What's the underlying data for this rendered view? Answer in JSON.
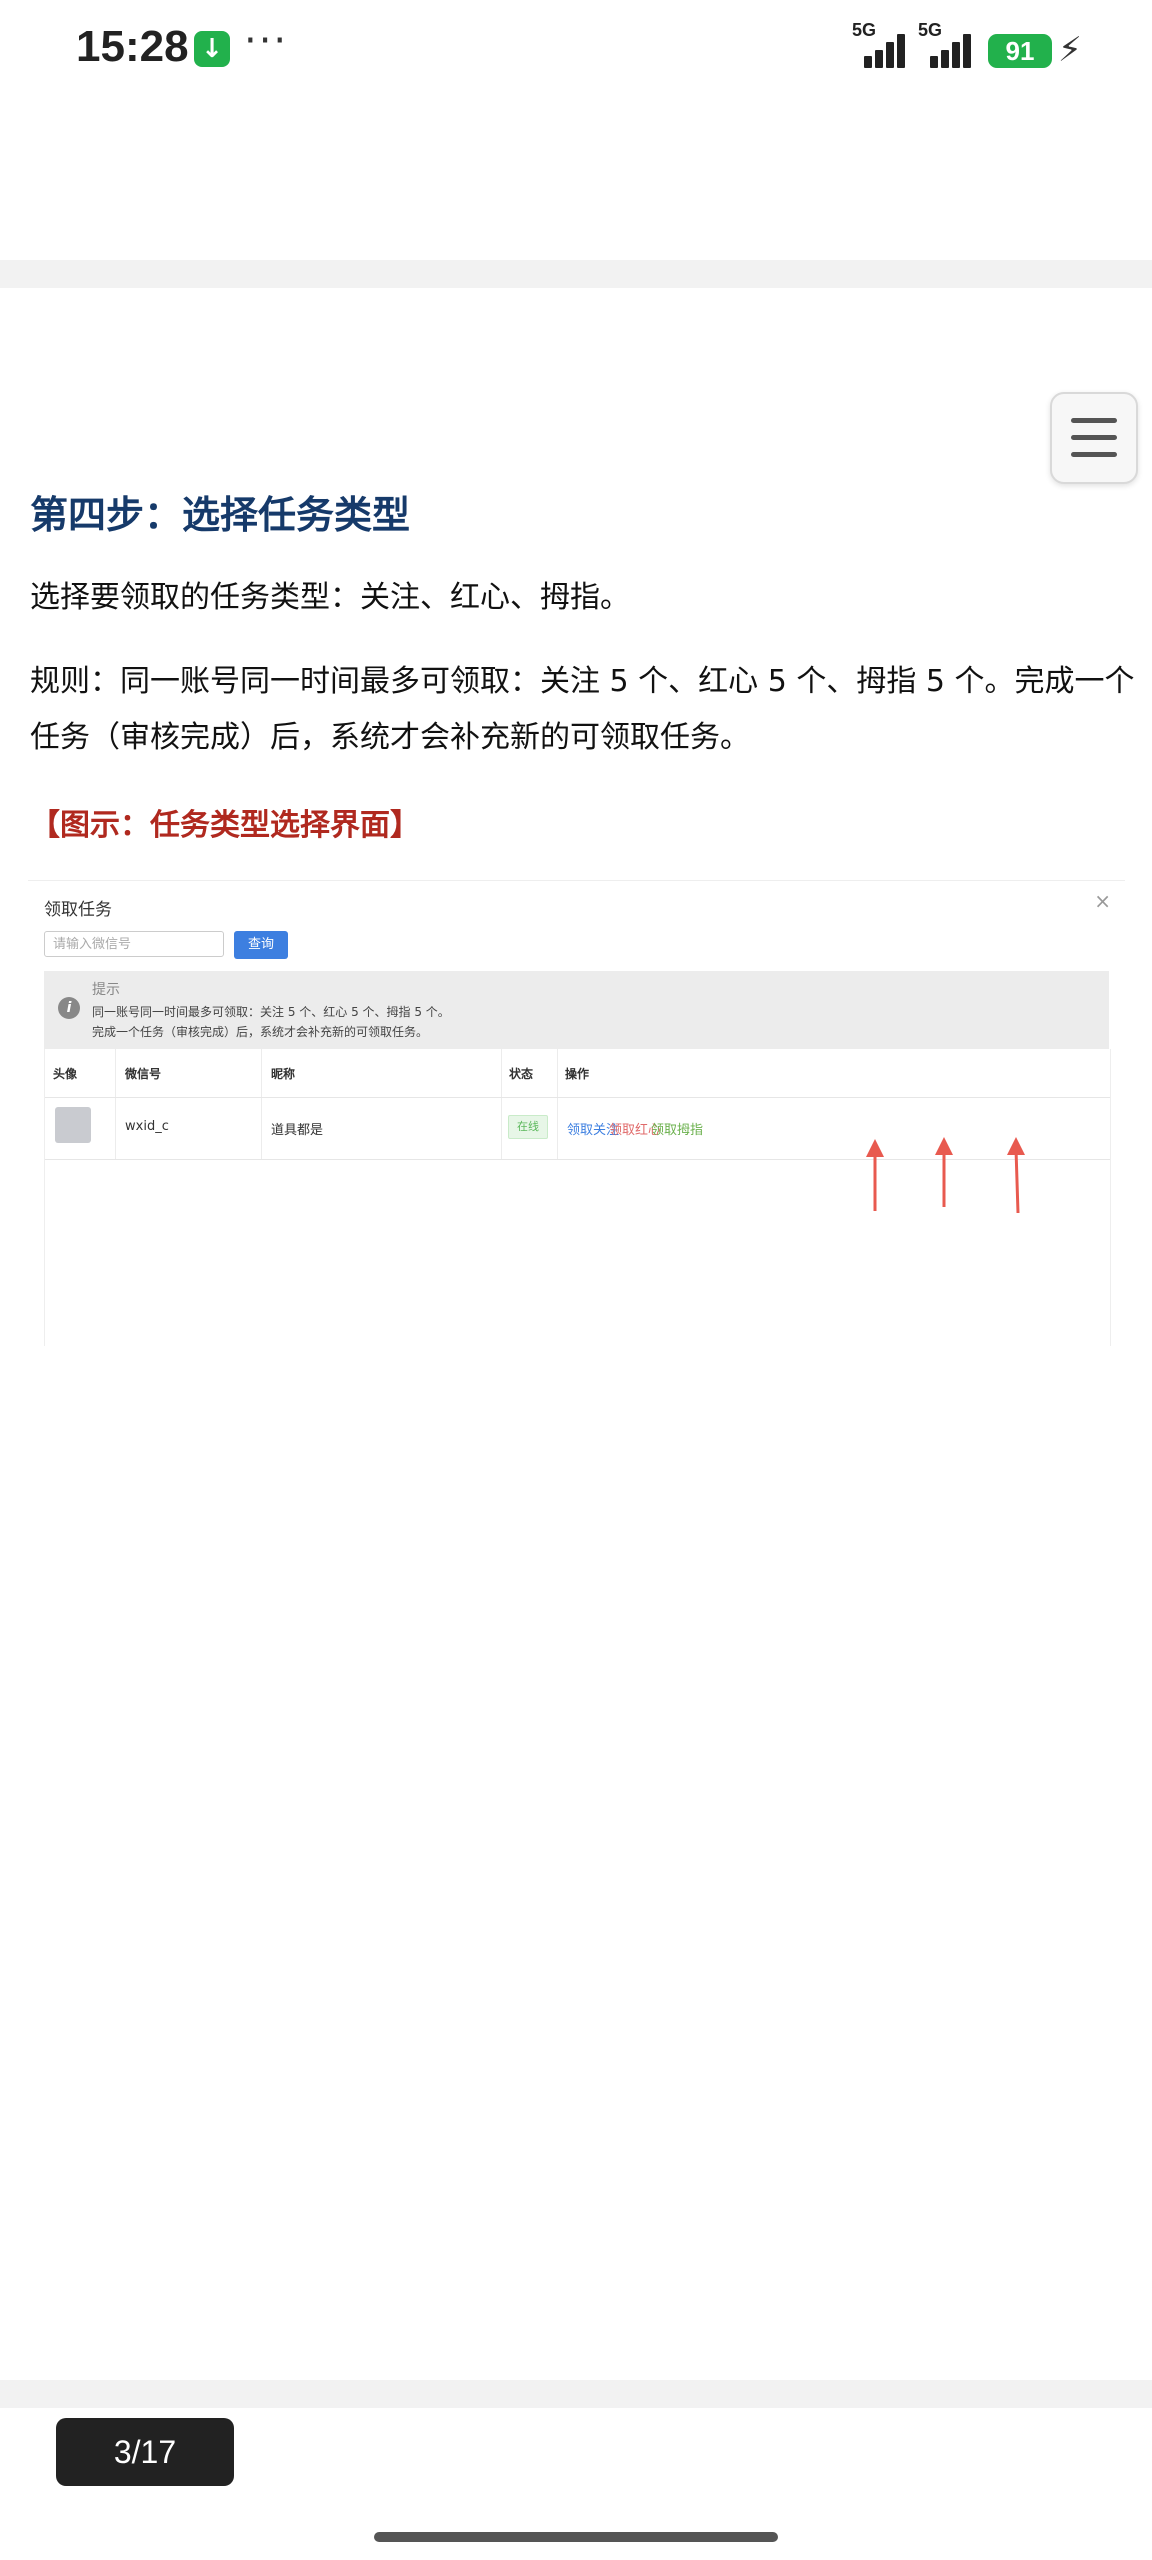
{
  "status_bar": {
    "time": "15:28",
    "download_icon": "arrow-down-icon",
    "more": "···",
    "network_1": "5G",
    "network_2": "5G",
    "battery": "91",
    "charging_icon": "bolt-icon"
  },
  "article": {
    "step_title": "第四步：选择任务类型",
    "intro": "选择要领取的任务类型：关注、红心、拇指。",
    "rule": "规则：同一账号同一时间最多可领取：关注 5 个、红心 5 个、拇指 5 个。完成一个任务（审核完成）后，系统才会补充新的可领取任务。",
    "figure_title": "【图示：任务类型选择界面】"
  },
  "screenshot": {
    "dialog_title": "领取任务",
    "close": "×",
    "search_placeholder": "请输入微信号",
    "search_button": "查询",
    "tip_title": "提示",
    "tip_line1": "同一账号同一时间最多可领取：关注 5 个、红心 5 个、拇指 5 个。",
    "tip_line2": "完成一个任务（审核完成）后，系统才会补充新的可领取任务。",
    "columns": [
      "头像",
      "微信号",
      "昵称",
      "状态",
      "操作"
    ],
    "row": {
      "wechat_id": "wxid_c",
      "nickname": "道具都是",
      "status": "在线",
      "actions": [
        "领取关注",
        "领取红心",
        "领取拇指"
      ]
    },
    "action_colors": [
      "#3d7fe0",
      "#e06a6a",
      "#6ab04c"
    ]
  },
  "page_indicator": "3/17"
}
